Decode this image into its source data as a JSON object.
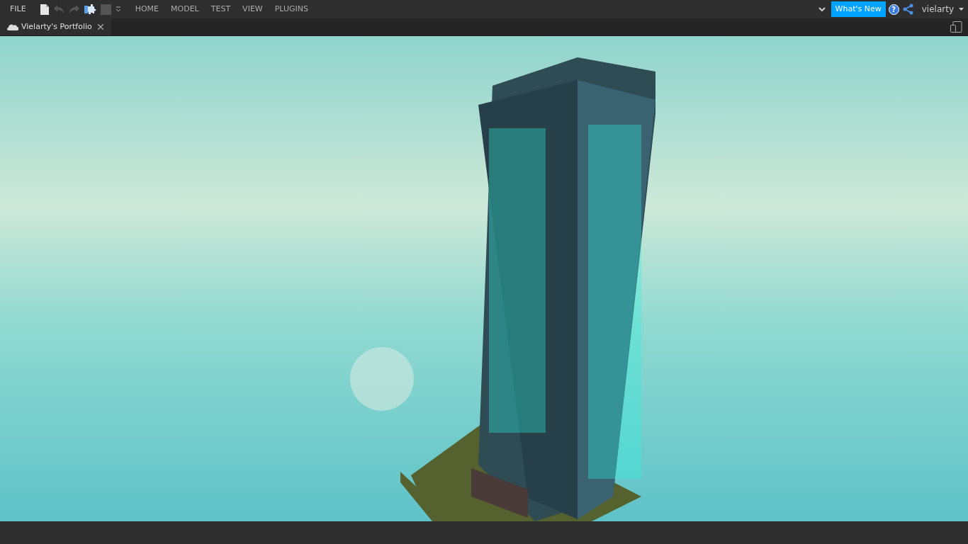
{
  "menu_bar": {
    "file_label": "FILE",
    "ribbon_tabs": [
      "HOME",
      "MODEL",
      "TEST",
      "VIEW",
      "PLUGINS"
    ],
    "whats_new": "What's New",
    "help_glyph": "?",
    "user_name": "vielarty"
  },
  "document_tabs": [
    {
      "title": "Vielarty's Portfolio"
    }
  ]
}
